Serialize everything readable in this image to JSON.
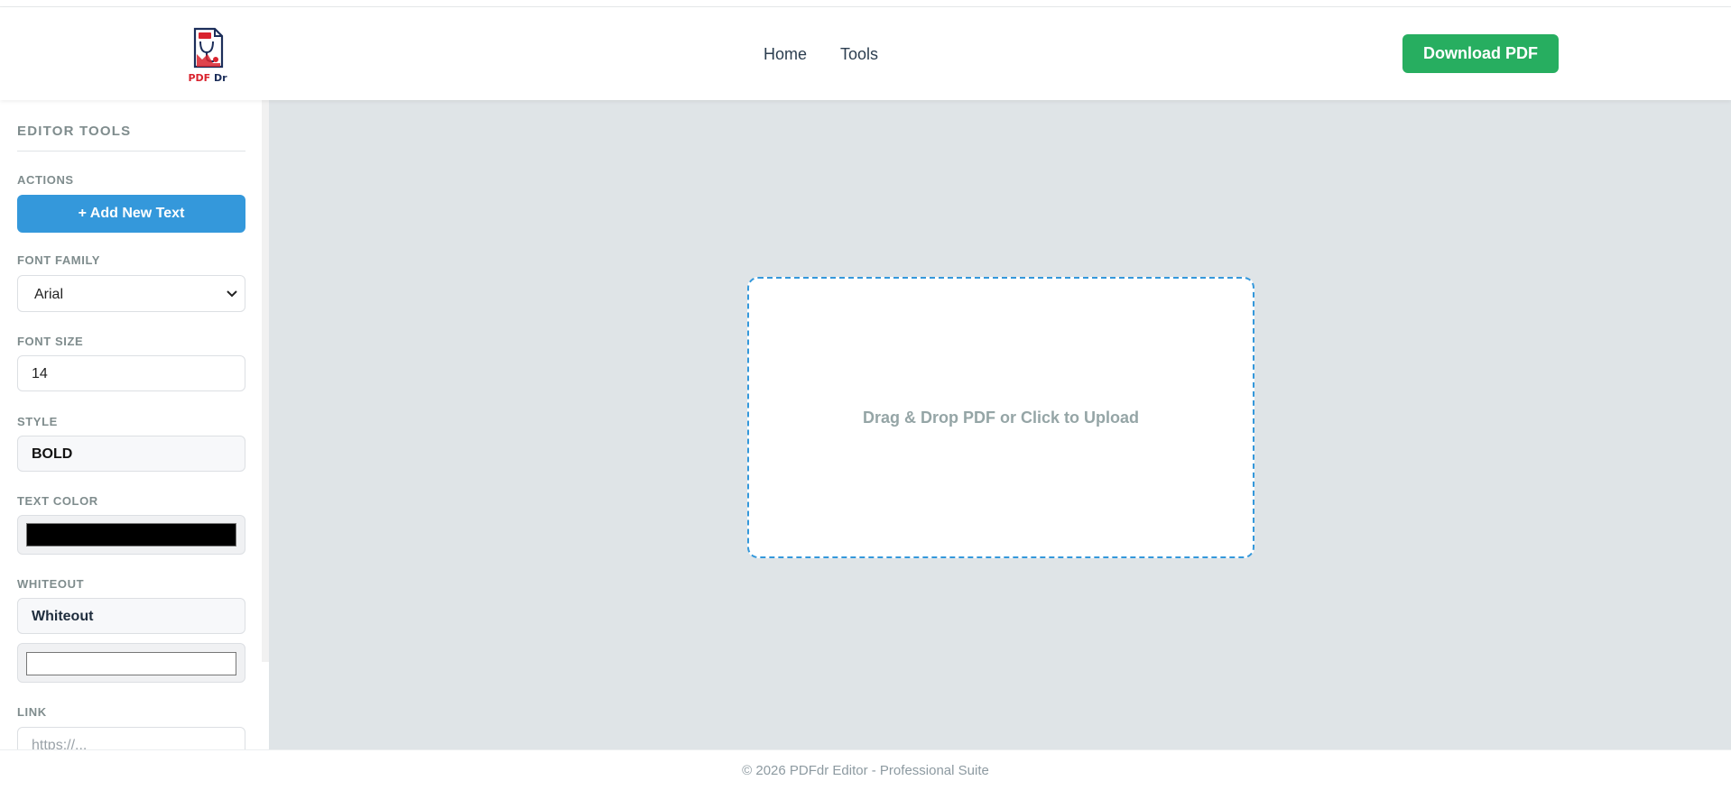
{
  "brand": {
    "logo_text_1": "PDF",
    "logo_text_2": "Dr"
  },
  "nav": {
    "items": [
      {
        "label": "Home"
      },
      {
        "label": "Tools"
      }
    ]
  },
  "header": {
    "download_label": "Download PDF"
  },
  "sidebar": {
    "title": "EDITOR TOOLS",
    "actions_label": "ACTIONS",
    "add_text_label": "+ Add New Text",
    "font_family_label": "FONT FAMILY",
    "font_family_value": "Arial",
    "font_size_label": "FONT SIZE",
    "font_size_value": "14",
    "style_label": "STYLE",
    "style_value": "BOLD",
    "text_color_label": "TEXT COLOR",
    "text_color_value": "#000000",
    "whiteout_label": "WHITEOUT",
    "whiteout_button": "Whiteout",
    "whiteout_color_value": "#ffffff",
    "link_label": "LINK",
    "link_placeholder": "https://..."
  },
  "canvas": {
    "dropzone_text": "Drag & Drop PDF or Click to Upload"
  },
  "footer": {
    "text": "© 2026 PDFdr Editor - Professional Suite"
  },
  "colors": {
    "primary": "#3498db",
    "success": "#27ae60",
    "canvas_bg": "#dfe4e7"
  }
}
